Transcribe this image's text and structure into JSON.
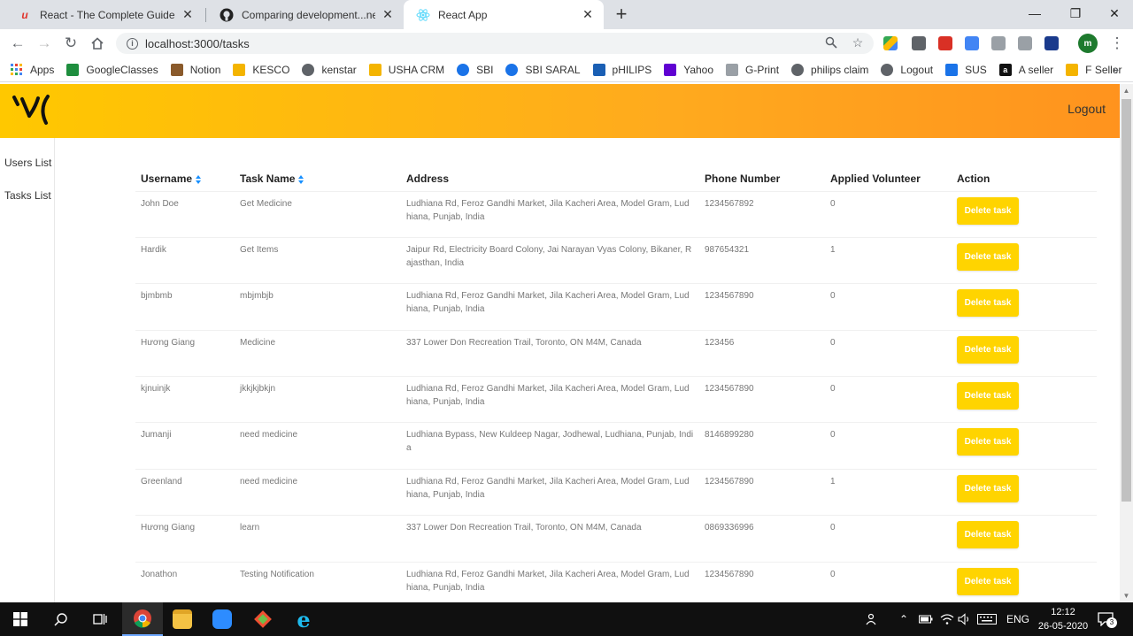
{
  "browser": {
    "tabs": [
      {
        "title": "React - The Complete Guide (incl",
        "icon": "udemy-icon"
      },
      {
        "title": "Comparing development...new-fe",
        "icon": "github-icon"
      },
      {
        "title": "React App",
        "icon": "react-icon"
      }
    ],
    "url": "localhost:3000/tasks",
    "bookmarks": [
      {
        "label": "Apps",
        "color": "#4285f4"
      },
      {
        "label": "GoogleClasses",
        "color": "#1e8e3e"
      },
      {
        "label": "Notion",
        "color": "#8a5a2b"
      },
      {
        "label": "KESCO",
        "color": "#f4b400"
      },
      {
        "label": "kenstar",
        "color": "#5f6368"
      },
      {
        "label": "USHA CRM",
        "color": "#f4b400"
      },
      {
        "label": "SBI",
        "color": "#1a73e8"
      },
      {
        "label": "SBI SARAL",
        "color": "#1a73e8"
      },
      {
        "label": "pHILIPS",
        "color": "#1a5fb4"
      },
      {
        "label": "Yahoo",
        "color": "#6001d2"
      },
      {
        "label": "G-Print",
        "color": "#5f6368"
      },
      {
        "label": "philips claim",
        "color": "#5f6368"
      },
      {
        "label": "Logout",
        "color": "#5f6368"
      },
      {
        "label": "SUS",
        "color": "#1a73e8"
      },
      {
        "label": "A seller",
        "color": "#111111"
      },
      {
        "label": "F Seller",
        "color": "#f4b400"
      }
    ]
  },
  "header": {
    "logout_label": "Logout"
  },
  "sidebar": {
    "items": [
      {
        "label": "Users List"
      },
      {
        "label": "Tasks List"
      }
    ]
  },
  "table": {
    "columns": [
      "Username",
      "Task Name",
      "Address",
      "Phone Number",
      "Applied Volunteer",
      "Action"
    ],
    "action_label": "Delete task",
    "rows": [
      {
        "username": "John Doe",
        "task": "Get Medicine",
        "address": "Ludhiana Rd, Feroz Gandhi Market, Jila Kacheri Area, Model Gram, Ludhiana, Punjab, India",
        "phone": "1234567892",
        "volunteers": "0"
      },
      {
        "username": "Hardik",
        "task": "Get Items",
        "address": "Jaipur Rd, Electricity Board Colony, Jai Narayan Vyas Colony, Bikaner, Rajasthan, India",
        "phone": "987654321",
        "volunteers": "1"
      },
      {
        "username": "bjmbmb",
        "task": "mbjmbjb",
        "address": "Ludhiana Rd, Feroz Gandhi Market, Jila Kacheri Area, Model Gram, Ludhiana, Punjab, India",
        "phone": "1234567890",
        "volunteers": "0"
      },
      {
        "username": "Hương Giang",
        "task": "Medicine",
        "address": "337 Lower Don Recreation Trail, Toronto, ON M4M, Canada",
        "phone": "123456",
        "volunteers": "0"
      },
      {
        "username": "kjnuinjk",
        "task": "jkkjkjbkjn",
        "address": "Ludhiana Rd, Feroz Gandhi Market, Jila Kacheri Area, Model Gram, Ludhiana, Punjab, India",
        "phone": "1234567890",
        "volunteers": "0"
      },
      {
        "username": "Jumanji",
        "task": "need medicine",
        "address": "Ludhiana Bypass, New Kuldeep Nagar, Jodhewal, Ludhiana, Punjab, India",
        "phone": "8146899280",
        "volunteers": "0"
      },
      {
        "username": "Greenland",
        "task": "need medicine",
        "address": "Ludhiana Rd, Feroz Gandhi Market, Jila Kacheri Area, Model Gram, Ludhiana, Punjab, India",
        "phone": "1234567890",
        "volunteers": "1"
      },
      {
        "username": "Hương Giang",
        "task": "learn",
        "address": "337 Lower Don Recreation Trail, Toronto, ON M4M, Canada",
        "phone": "0869336996",
        "volunteers": "0"
      },
      {
        "username": "Jonathon",
        "task": "Testing Notification",
        "address": "Ludhiana Rd, Feroz Gandhi Market, Jila Kacheri Area, Model Gram, Ludhiana, Punjab, India",
        "phone": "1234567890",
        "volunteers": "0"
      }
    ]
  },
  "taskbar": {
    "language": "ENG",
    "time": "12:12",
    "date": "26-05-2020",
    "notification_count": "3"
  },
  "colors": {
    "header_start": "#ffc800",
    "header_end": "#ff931e",
    "delete_button": "#ffd400",
    "sort_icon": "#1890ff"
  }
}
